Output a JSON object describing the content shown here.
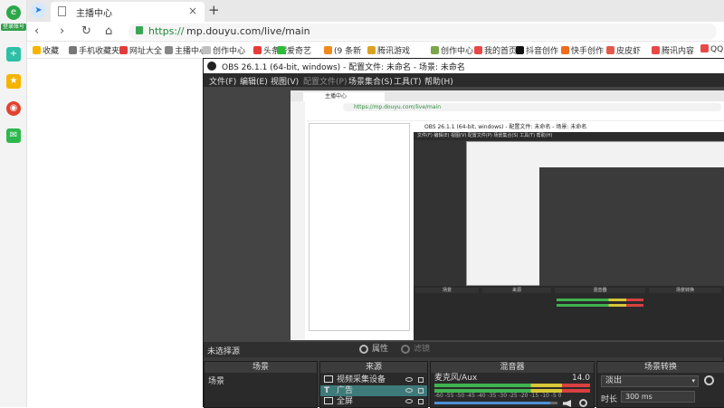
{
  "browser": {
    "login_badge": "登录账号",
    "tab": {
      "title": "主播中心"
    },
    "address": {
      "scheme": "https://",
      "url": "mp.douyu.com/live/main"
    },
    "nav": {
      "back": "‹",
      "forward": "›",
      "refresh": "↻",
      "home": "⌂",
      "new_tab": "+"
    },
    "bookmarks": [
      {
        "label": "收藏",
        "color": "#f5b400"
      },
      {
        "label": "手机收藏夹",
        "color": "#777777"
      },
      {
        "label": "网址大全",
        "color": "#e23b3b"
      },
      {
        "label": "主播中心",
        "color": "#888888"
      },
      {
        "label": "创作中心",
        "color": "#c0c0c0"
      },
      {
        "label": "头条号",
        "color": "#e83a3a"
      },
      {
        "label": "爱奇艺",
        "color": "#2dbb39"
      },
      {
        "label": "(9 条新",
        "color": "#f08b1a"
      },
      {
        "label": "腾讯游戏",
        "color": "#d9a322"
      },
      {
        "label": "创作中心",
        "color": "#7aa74b"
      },
      {
        "label": "我的首页",
        "color": "#e84848"
      },
      {
        "label": "抖音创作",
        "color": "#111111"
      },
      {
        "label": "快手创作",
        "color": "#f26b1d"
      },
      {
        "label": "皮皮虾",
        "color": "#e45a4a"
      },
      {
        "label": "腾讯内容",
        "color": "#e84848"
      },
      {
        "label": "QQ",
        "color": "#e84848"
      }
    ],
    "rail_colors": [
      "#2cc0a6",
      "#f5b400",
      "#e2412f",
      "#2db84e"
    ]
  },
  "obs": {
    "title": "OBS 26.1.1 (64-bit, windows) - 配置文件: 未命名 - 场景: 未命名",
    "menu": [
      "文件(F)",
      "编辑(E)",
      "视图(V)",
      "配置文件(P)",
      "场景集合(S)",
      "工具(T)",
      "帮助(H)"
    ],
    "no_source": "未选择源",
    "properties": "属性",
    "filters": "滤镜",
    "scenes": {
      "header": "场景",
      "items": [
        "场景"
      ]
    },
    "sources": {
      "header": "来源",
      "items": [
        {
          "label": "视频采集设备",
          "selected": false
        },
        {
          "label": "广告",
          "selected": true
        },
        {
          "label": "全屏",
          "selected": false
        }
      ]
    },
    "mixer": {
      "header": "混音器",
      "channel": "麦克风/Aux",
      "level": "14.0",
      "scale": "-60 -55 -50 -45 -40 -35 -30 -25 -20 -15 -10 -5 0"
    },
    "transitions": {
      "header": "场景转换",
      "type": "淡出",
      "duration_label": "时长",
      "duration": "300 ms"
    },
    "nested": {
      "tab": "主播中心",
      "url": "https://mp.douyu.com/live/main",
      "title": "OBS 26.1.1 (64-bit, windows) - 配置文件: 未命名 - 场景: 未命名",
      "menu": "文件(F)  编辑(E)  视图(V)  配置文件(P)  场景集合(S)  工具(T)  帮助(H)"
    }
  }
}
